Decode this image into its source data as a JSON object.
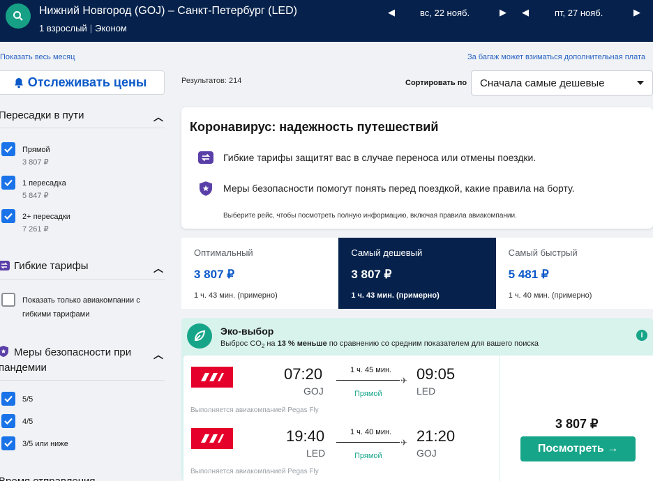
{
  "header": {
    "route": "Нижний Новгород (GOJ) – Санкт-Петербург (LED)",
    "passengers": "1 взрослый",
    "cabin": "Эконом",
    "depart_date": "вс, 22 нояб.",
    "return_date": "пт, 27 нояб."
  },
  "links": {
    "show_month": "Показать весь месяц",
    "baggage_note": "За багаж может взиматься дополнительная плата"
  },
  "sidebar": {
    "track_label": "Отслеживать цены",
    "stops": {
      "title": "Пересадки в пути",
      "items": [
        {
          "label": "Прямой",
          "price": "3 807 ₽",
          "checked": true
        },
        {
          "label": "1 пересадка",
          "price": "5 847 ₽",
          "checked": true
        },
        {
          "label": "2+ пересадки",
          "price": "7 261 ₽",
          "checked": true
        }
      ]
    },
    "flexible": {
      "title": "Гибкие тарифы",
      "option_line1": "Показать только авиакомпании с",
      "option_line2": "гибкими тарифами",
      "checked": false
    },
    "safety": {
      "title_line1": "Меры безопасности при",
      "title_line2": "пандемии",
      "items": [
        {
          "label": "5/5",
          "checked": true
        },
        {
          "label": "4/5",
          "checked": true
        },
        {
          "label": "3/5 или ниже",
          "checked": true
        }
      ]
    },
    "next_section": "Время отправления"
  },
  "results": {
    "count_label": "Результатов: 214",
    "sort_label": "Сортировать по",
    "sort_value": "Сначала самые дешевые"
  },
  "covid": {
    "title": "Коронавирус: надежность путешествий",
    "line1": "Гибкие тарифы защитят вас в случае переноса или отмены поездки.",
    "line2": "Меры безопасности помогут понять перед поездкой, какие правила на борту.",
    "note": "Выберите рейс, чтобы посмотреть полную информацию, включая правила авиакомпании."
  },
  "tabs": [
    {
      "title": "Оптимальный",
      "price": "3 807 ₽",
      "duration": "1 ч. 43 мин. (примерно)",
      "active": false
    },
    {
      "title": "Самый дешевый",
      "price": "3 807 ₽",
      "duration": "1 ч. 43 мин. (примерно)",
      "active": true
    },
    {
      "title": "Самый быстрый",
      "price": "5 481 ₽",
      "duration": "1 ч. 40 мин. (примерно)",
      "active": false
    }
  ],
  "eco": {
    "title": "Эко-выбор",
    "sub_pre": "Выброс CO",
    "sub_sub": "2",
    "sub_mid": " на ",
    "sub_bold": "13 % меньше",
    "sub_post": " по сравнению со средним показателем для вашего поиска",
    "info": "i"
  },
  "flight": {
    "legs": [
      {
        "dep_time": "07:20",
        "dep_code": "GOJ",
        "duration": "1 ч. 45 мин.",
        "stops": "Прямой",
        "arr_time": "09:05",
        "arr_code": "LED",
        "operator": "Выполняется авиакомпанией Pegas Fly"
      },
      {
        "dep_time": "19:40",
        "dep_code": "LED",
        "duration": "1 ч. 40 мин.",
        "stops": "Прямой",
        "arr_time": "21:20",
        "arr_code": "GOJ",
        "operator": "Выполняется авиакомпанией Pegas Fly"
      }
    ],
    "price": "3 807 ₽",
    "view_label": "Посмотреть →"
  },
  "colors": {
    "navy": "#06224c",
    "teal": "#17a589",
    "blue": "#0b59c9",
    "airline_red": "#e4002b"
  }
}
